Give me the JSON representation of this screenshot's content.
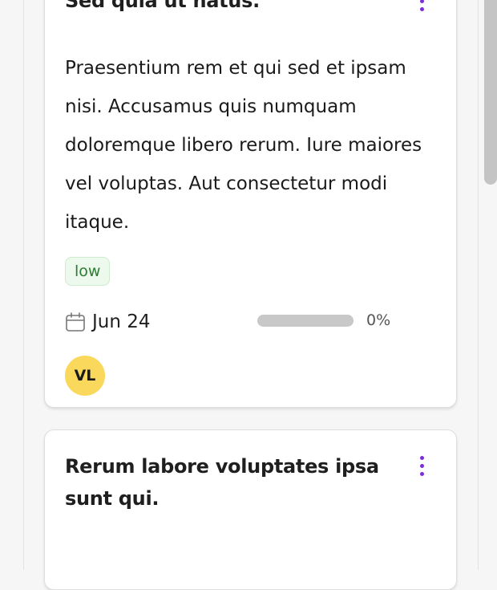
{
  "cards": [
    {
      "title": "Sed quia ut natus.",
      "description": "Praesentium rem et qui sed et ipsam nisi. Accusamus quis numquam doloremque libero rerum. Iure maiores vel voluptas. Aut consectetur modi itaque.",
      "priority": "low",
      "due_date": "Jun 24",
      "progress": 0,
      "progress_label": "0%",
      "assignee_initials": "VL",
      "icons": {
        "menu": "more-vertical-icon",
        "calendar": "calendar-icon"
      }
    },
    {
      "title": "Rerum labore voluptates ipsa sunt qui.",
      "icons": {
        "menu": "more-vertical-icon"
      }
    }
  ],
  "colors": {
    "accent": "#7b2ddb",
    "priority_low_bg": "#ecf9ec",
    "priority_low_text": "#2d7a33",
    "avatar_bg": "#f9d85c",
    "progress_track": "#c8c8c8"
  }
}
